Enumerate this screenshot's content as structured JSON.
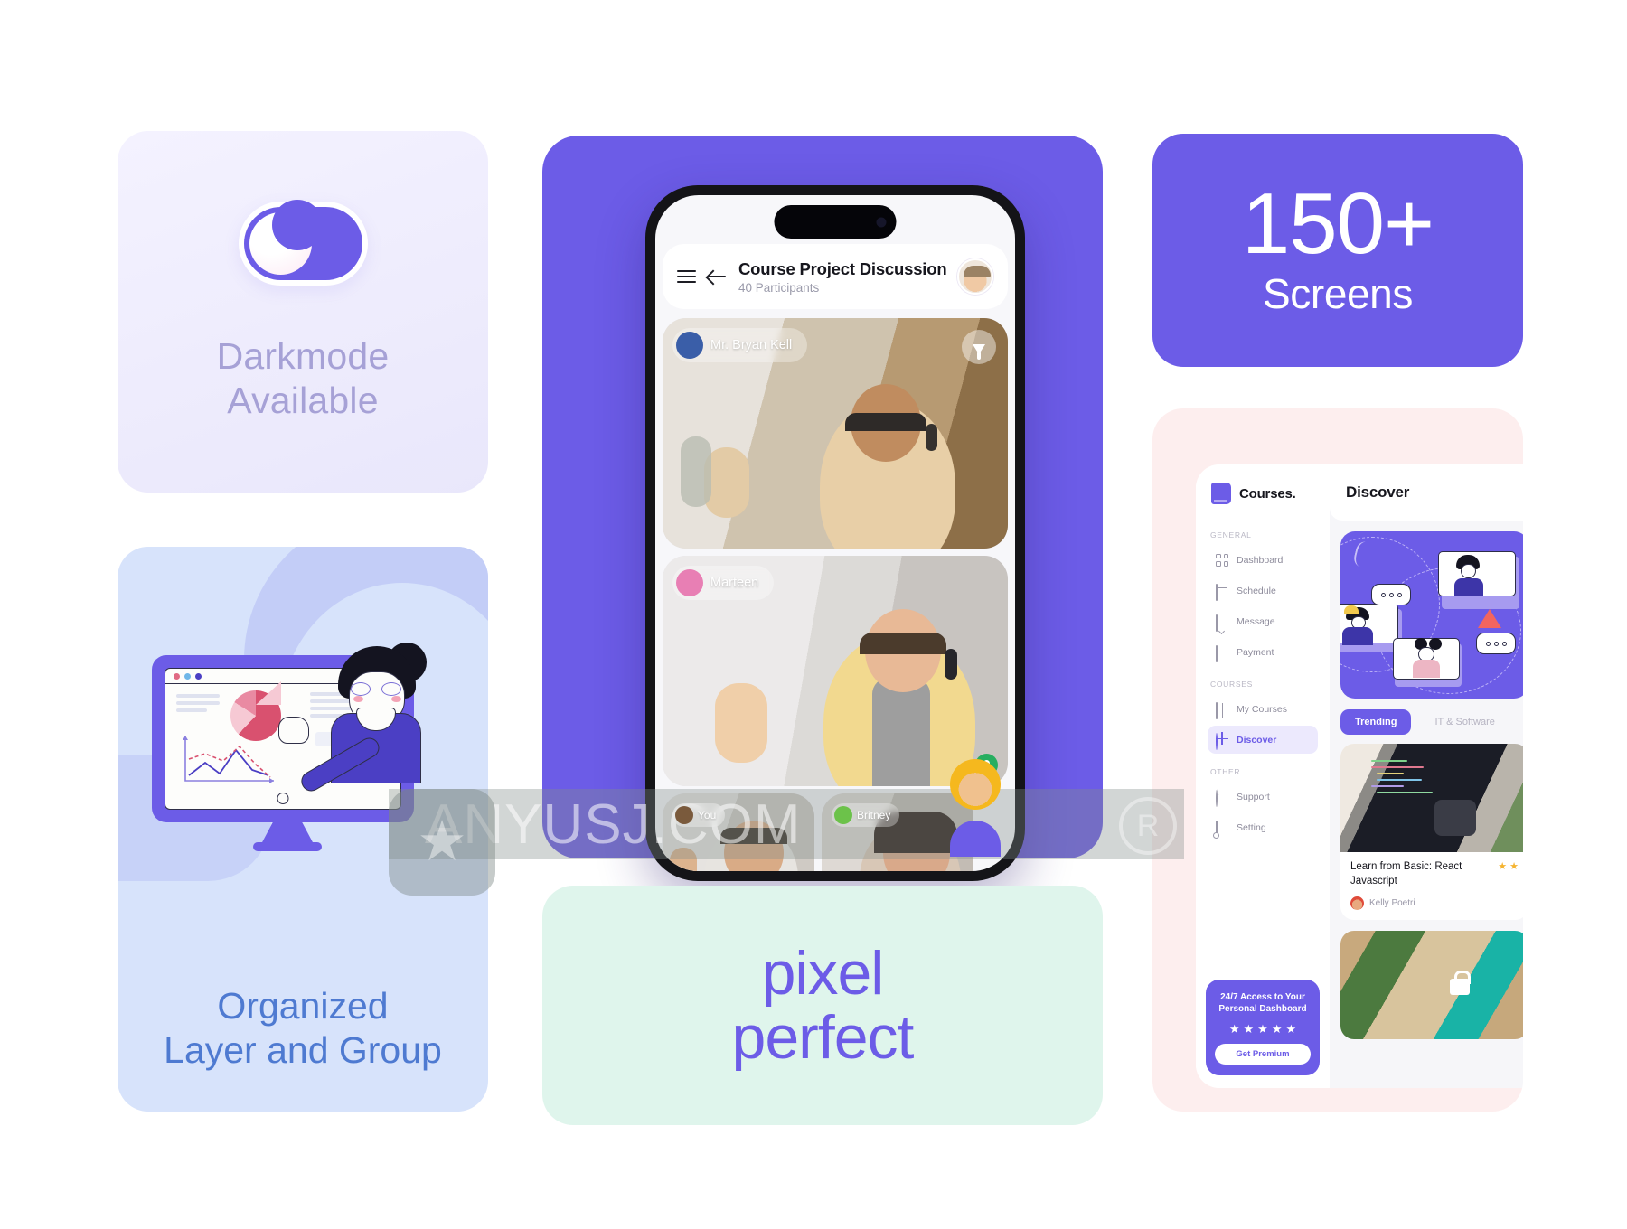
{
  "darkmode_card": {
    "toggle_name": "darkmode-toggle",
    "toggle_state": "on",
    "label": "Darkmode\nAvailable"
  },
  "organized_card": {
    "label": "Organized\nLayer and Group",
    "illustration": "person-presenting-dashboard-on-monitor"
  },
  "phone": {
    "app_title": "Course Project Discussion",
    "participants": "40 Participants",
    "menu_icon": "hamburger-menu-icon",
    "back_icon": "back-arrow-icon",
    "avatar_icon": "profile-avatar",
    "tiles": [
      {
        "name": "Mr. Bryan Kell",
        "avatar_color": "#3a5ea8",
        "pinned": true
      },
      {
        "name": "Marteen",
        "avatar_color": "#e87fb4",
        "pinned": false,
        "mic": true
      },
      {
        "name": "You",
        "avatar_color": "#7a5a3c",
        "pinned": false
      },
      {
        "name": "Britney",
        "avatar_color": "#6cc24a",
        "pinned": false
      }
    ],
    "side_avatars": [
      "#f5b81e",
      "#6c5ce7"
    ]
  },
  "pixel_card": {
    "line1": "pixel",
    "line2": "perfect"
  },
  "screens_card": {
    "number": "150+",
    "caption": "Screens"
  },
  "dashboard": {
    "brand": "Courses.",
    "brand_icon": "book-icon",
    "nav_groups": [
      {
        "label": "GENERAL",
        "items": [
          {
            "label": "Dashboard",
            "icon": "grid-icon",
            "active": false
          },
          {
            "label": "Schedule",
            "icon": "calendar-icon",
            "active": false
          },
          {
            "label": "Message",
            "icon": "chat-bubble-icon",
            "active": false
          },
          {
            "label": "Payment",
            "icon": "money-icon",
            "active": false
          }
        ]
      },
      {
        "label": "COURSES",
        "items": [
          {
            "label": "My Courses",
            "icon": "open-book-icon",
            "active": false
          },
          {
            "label": "Discover",
            "icon": "globe-icon",
            "active": true
          }
        ]
      },
      {
        "label": "OTHER",
        "items": [
          {
            "label": "Support",
            "icon": "info-circle-icon",
            "active": false
          },
          {
            "label": "Setting",
            "icon": "gear-icon",
            "active": false
          }
        ]
      }
    ],
    "premium": {
      "title": "24/7 Access to Your Personal Dashboard",
      "stars": 5,
      "button": "Get Premium"
    },
    "main": {
      "title": "Discover",
      "hero_illustration": "video-call-people-illustration",
      "tabs": [
        {
          "label": "Trending",
          "active": true
        },
        {
          "label": "IT & Software",
          "active": false
        }
      ],
      "course": {
        "title": "Learn from Basic: React Javascript",
        "author": "Kelly Poetri",
        "stars": 2,
        "thumbnail": "laptop-with-code-photo"
      },
      "course2": {
        "thumbnail": "phone-with-lock-icon-photo"
      }
    }
  },
  "watermark": {
    "text": "ANYUSJ.COM",
    "badge_icon": "star-badge-icon",
    "registered_mark": "R"
  },
  "colors": {
    "brand_purple": "#6c5ce7",
    "mint": "#dff5ec",
    "blue_card": "#d7e3fb",
    "pink_card": "#fdeeee",
    "lavender_card": "#eeecfb"
  }
}
